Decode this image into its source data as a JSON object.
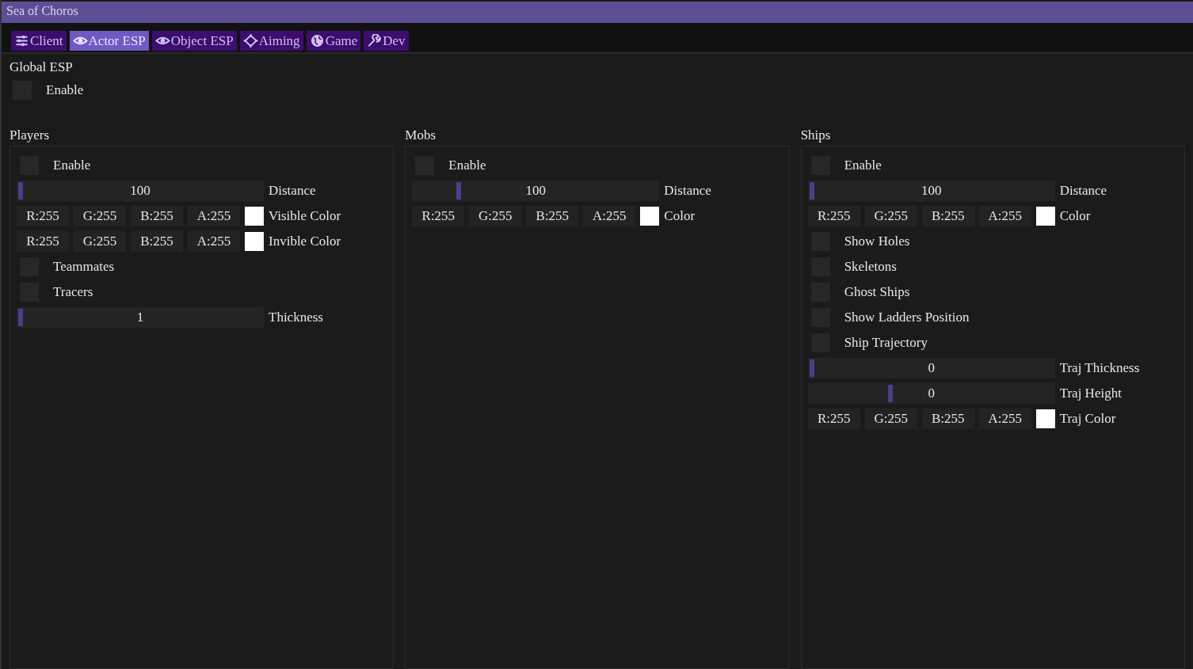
{
  "window": {
    "title": "Sea of Choros"
  },
  "tabs": [
    {
      "label": "Client",
      "selected": false
    },
    {
      "label": "Actor ESP",
      "selected": true
    },
    {
      "label": "Object ESP",
      "selected": false
    },
    {
      "label": "Aiming",
      "selected": false
    },
    {
      "label": "Game",
      "selected": false
    },
    {
      "label": "Dev",
      "selected": false
    }
  ],
  "global": {
    "title": "Global ESP",
    "items": [
      {
        "kind": "checkbox",
        "label": "Enable",
        "checked": false
      }
    ]
  },
  "sections": [
    {
      "title": "Players",
      "items": [
        {
          "kind": "checkbox",
          "label": "Enable",
          "checked": false
        },
        {
          "kind": "slider",
          "reading": "100",
          "label": "Distance",
          "level": 0.0
        },
        {
          "kind": "color",
          "channels": [
            "R:255",
            "G:255",
            "B:255",
            "A:255"
          ],
          "color": "#ffffff",
          "label": "Visible Color"
        },
        {
          "kind": "color",
          "channels": [
            "R:255",
            "G:255",
            "B:255",
            "A:255"
          ],
          "color": "#ffffff",
          "label": "Invible Color"
        },
        {
          "kind": "checkbox",
          "label": "Teammates",
          "checked": false
        },
        {
          "kind": "checkbox",
          "label": "Tracers",
          "checked": false
        },
        {
          "kind": "slider",
          "reading": "1",
          "label": "Thickness",
          "level": 0.0
        }
      ]
    },
    {
      "title": "Mobs",
      "items": [
        {
          "kind": "checkbox",
          "label": "Enable",
          "checked": false
        },
        {
          "kind": "slider",
          "reading": "100",
          "label": "Distance",
          "level": 0.18
        },
        {
          "kind": "color",
          "channels": [
            "R:255",
            "G:255",
            "B:255",
            "A:255"
          ],
          "color": "#ffffff",
          "label": "Color"
        }
      ]
    },
    {
      "title": "Ships",
      "items": [
        {
          "kind": "checkbox",
          "label": "Enable",
          "checked": false
        },
        {
          "kind": "slider",
          "reading": "100",
          "label": "Distance",
          "level": 0.0
        },
        {
          "kind": "color",
          "channels": [
            "R:255",
            "G:255",
            "B:255",
            "A:255"
          ],
          "color": "#ffffff",
          "label": "Color"
        },
        {
          "kind": "checkbox",
          "label": "Show Holes",
          "checked": false
        },
        {
          "kind": "checkbox",
          "label": "Skeletons",
          "checked": false
        },
        {
          "kind": "checkbox",
          "label": "Ghost Ships",
          "checked": false
        },
        {
          "kind": "checkbox",
          "label": "Show Ladders Position",
          "checked": false
        },
        {
          "kind": "checkbox",
          "label": "Ship Trajectory",
          "checked": false
        },
        {
          "kind": "slider",
          "reading": "0",
          "label": "Traj Thickness",
          "level": 0.0
        },
        {
          "kind": "slider",
          "reading": "0",
          "label": "Traj Height",
          "level": 0.33
        },
        {
          "kind": "color",
          "channels": [
            "R:255",
            "G:255",
            "B:255",
            "A:255"
          ],
          "color": "#ffffff",
          "label": "Traj Color"
        }
      ]
    }
  ]
}
